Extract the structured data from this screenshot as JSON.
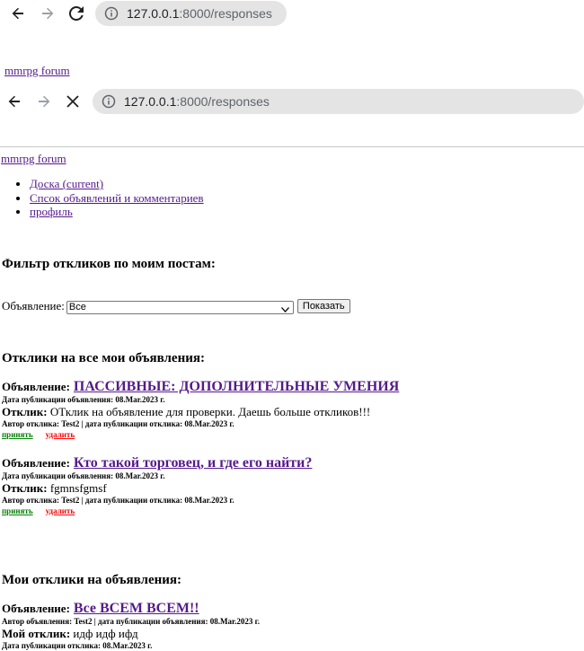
{
  "browser_top": {
    "url_host": "127.0.0.1",
    "url_path": ":8000/responses"
  },
  "browser_second": {
    "url_host": "127.0.0.1",
    "url_path": ":8000/responses"
  },
  "site_link_top": "mmrpg forum",
  "site_link": "mmrpg forum",
  "nav": [
    {
      "label": "Доска (current)"
    },
    {
      "label": "Спсок объявлений и комментариев"
    },
    {
      "label": "профиль"
    }
  ],
  "filter": {
    "title": "Фильтр откликов по моим постам:",
    "label": "Объявление:",
    "selected": "Все",
    "button": "Показать"
  },
  "responses_section": {
    "title": "Отклики на все мои объявления:",
    "items": [
      {
        "ad_label": "Объявление:",
        "ad_title": "ПАССИВНЫЕ: ДОПОЛНИТЕЛЬНЫЕ УМЕНИЯ",
        "ad_date": "Дата публикации объявления: 08.Mar.2023 г.",
        "resp_label": "Отклик:",
        "resp_text": "ОТклик на объявление для проверки. Даешь больше откликов!!!",
        "resp_meta": "Автор отклика: Test2 | дата публикации отклика: 08.Mar.2023 г.",
        "accept": "принять",
        "delete": "удалить"
      },
      {
        "ad_label": "Объявление:",
        "ad_title": "Кто такой торговец, и где его найти?",
        "ad_date": "Дата публикации объявления: 08.Mar.2023 г.",
        "resp_label": "Отклик:",
        "resp_text": "fgmnsfgmsf",
        "resp_meta": "Автор отклика: Test2 | дата публикации отклика: 08.Mar.2023 г.",
        "accept": "принять",
        "delete": "удалить"
      }
    ]
  },
  "my_responses": {
    "title": "Мои отклики на объявления:",
    "items": [
      {
        "ad_label": "Объявление:",
        "ad_title": "Все ВСЕМ ВСЕМ!!",
        "ad_meta": "Автор объявления: Test2 | дата публикации объявления: 08.Mar.2023 г.",
        "resp_label": "Мой отклик:",
        "resp_text": "идф идф ифд",
        "resp_date": "Дата публикации отклика: 08.Mar.2023 г."
      }
    ]
  }
}
